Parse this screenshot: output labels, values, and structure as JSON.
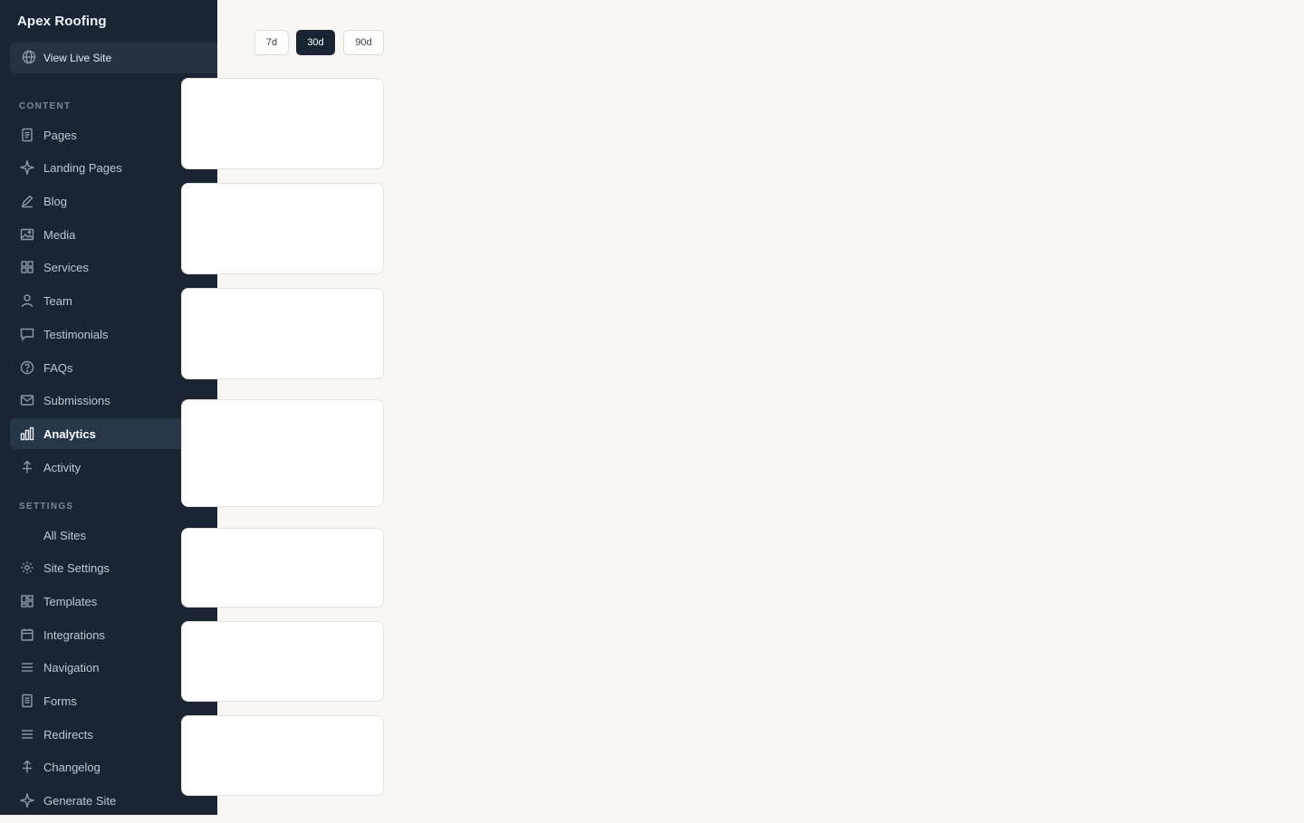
{
  "sidebar": {
    "brand": "Apex Roofing",
    "live_site_label": "View Live Site",
    "content_section_label": "CONTENT",
    "content_items": [
      {
        "label": "Pages",
        "icon": "page-icon"
      },
      {
        "label": "Landing Pages",
        "icon": "sparkle-icon"
      },
      {
        "label": "Blog",
        "icon": "pencil-icon"
      },
      {
        "label": "Media",
        "icon": "image-icon"
      },
      {
        "label": "Services",
        "icon": "grid-icon"
      },
      {
        "label": "Team",
        "icon": "user-icon"
      },
      {
        "label": "Testimonials",
        "icon": "chat-icon"
      },
      {
        "label": "FAQs",
        "icon": "question-icon"
      },
      {
        "label": "Submissions",
        "icon": "mail-icon"
      },
      {
        "label": "Analytics",
        "icon": "bar-chart-icon",
        "active": true
      },
      {
        "label": "Activity",
        "icon": "pulse-icon"
      }
    ],
    "settings_section_label": "SETTINGS",
    "settings_items": [
      {
        "label": "All Sites",
        "icon": ""
      },
      {
        "label": "Site Settings",
        "icon": "gear-icon"
      },
      {
        "label": "Templates",
        "icon": "template-icon"
      },
      {
        "label": "Integrations",
        "icon": "calendar-icon"
      },
      {
        "label": "Navigation",
        "icon": "menu-icon"
      },
      {
        "label": "Forms",
        "icon": "form-icon"
      },
      {
        "label": "Redirects",
        "icon": "menu-icon"
      },
      {
        "label": "Changelog",
        "icon": "pulse-icon"
      },
      {
        "label": "Generate Site",
        "icon": "sparkle-icon"
      }
    ]
  },
  "range": {
    "options": [
      "7d",
      "30d",
      "90d"
    ],
    "selected": "30d"
  },
  "colors": {
    "sidebar_bg": "#1b2433",
    "active_item_bg": "#28364a",
    "page_bg": "#f8f7f4"
  }
}
